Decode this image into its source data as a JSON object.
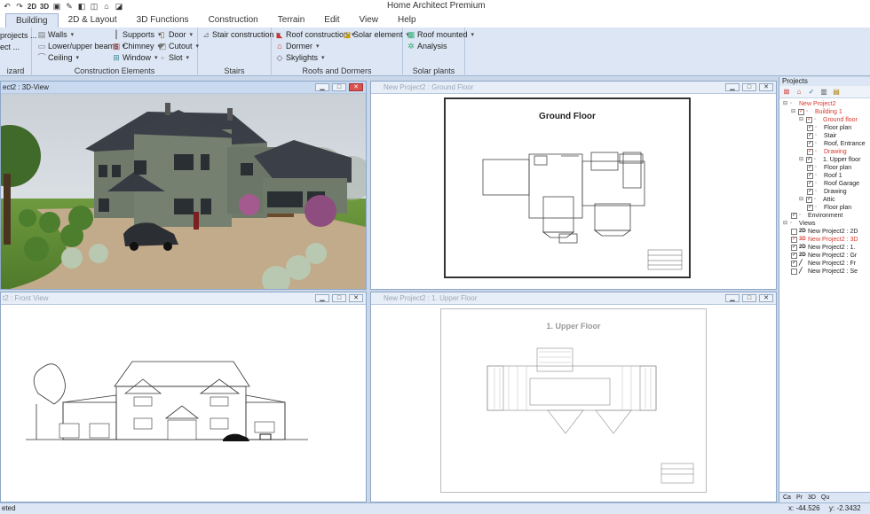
{
  "window": {
    "title": "Home Architect Premium"
  },
  "quick_access": [
    "↶",
    "↷",
    "2D",
    "3D"
  ],
  "tabs": [
    "Building",
    "2D & Layout",
    "3D Functions",
    "Construction",
    "Terrain",
    "Edit",
    "View",
    "Help"
  ],
  "ribbon": {
    "wizard": {
      "items": [
        "projects ...",
        "ect ..."
      ],
      "caption": "izard"
    },
    "construction": {
      "col1": [
        "Walls",
        "Lower/upper beams",
        "Ceiling"
      ],
      "col2": [
        "Supports",
        "Chimney",
        "Window"
      ],
      "col3": [
        "Door",
        "Cutout",
        "Slot"
      ],
      "caption": "Construction Elements"
    },
    "stairs": {
      "items": [
        "Stair construction"
      ],
      "caption": "Stairs"
    },
    "roofs": {
      "items": [
        "Roof construction",
        "Dormer",
        "Skylights",
        "Solar element"
      ],
      "caption": "Roofs and Dormers"
    },
    "solar": {
      "items": [
        "Roof mounted",
        "Analysis"
      ],
      "caption": "Solar plants"
    }
  },
  "views": [
    {
      "title": "ect2 : 3D-View",
      "active": true
    },
    {
      "title": "New Project2 : Ground Floor",
      "drawing_title": "Ground Floor"
    },
    {
      "title": "t2 : Front View"
    },
    {
      "title": "New Project2 : 1. Upper Floor",
      "drawing_title": "1. Upper Floor"
    }
  ],
  "projects_panel": {
    "title": "Projects",
    "tree": [
      {
        "label": "New Project2",
        "level": 0,
        "red": true,
        "toggle": "⊟"
      },
      {
        "label": "Building 1",
        "level": 1,
        "red": true,
        "checked": true,
        "toggle": "⊟"
      },
      {
        "label": "Ground floor",
        "level": 2,
        "red": true,
        "checked": true,
        "toggle": "⊟"
      },
      {
        "label": "Floor plan",
        "level": 3,
        "checked": true
      },
      {
        "label": "Stair",
        "level": 3,
        "checked": true
      },
      {
        "label": "Roof, Entrance",
        "level": 3,
        "checked": true
      },
      {
        "label": "Drawing",
        "level": 3,
        "checked": true,
        "red": true
      },
      {
        "label": "1. Upper floor",
        "level": 2,
        "checked": true,
        "toggle": "⊟"
      },
      {
        "label": "Floor plan",
        "level": 3,
        "checked": true
      },
      {
        "label": "Roof 1",
        "level": 3,
        "checked": true
      },
      {
        "label": "Roof Garage",
        "level": 3,
        "checked": true
      },
      {
        "label": "Drawing",
        "level": 3,
        "checked": true
      },
      {
        "label": "Attic",
        "level": 2,
        "checked": true,
        "toggle": "⊟"
      },
      {
        "label": "Floor plan",
        "level": 3,
        "checked": true
      },
      {
        "label": "Environment",
        "level": 1,
        "checked": true
      },
      {
        "label": "Views",
        "level": 0,
        "toggle": "⊟"
      },
      {
        "label": "New Project2 : 2D",
        "level": 1,
        "checked": false,
        "badge": "2D"
      },
      {
        "label": "New Project2 : 3D",
        "level": 1,
        "checked": true,
        "badge": "3D",
        "red": true
      },
      {
        "label": "New Project2 : 1.",
        "level": 1,
        "checked": true,
        "badge": "2D"
      },
      {
        "label": "New Project2 : Gr",
        "level": 1,
        "checked": true,
        "badge": "2D"
      },
      {
        "label": "New Project2 : Fr",
        "level": 1,
        "checked": true,
        "badge": "╱"
      },
      {
        "label": "New Project2 : Se",
        "level": 1,
        "checked": false,
        "badge": "╱"
      }
    ],
    "bottom_tabs": [
      "Ca",
      "Pr",
      "3D",
      "Qu"
    ]
  },
  "status": {
    "message": "eted",
    "x": "x: -44.526",
    "y": "y: -2.3432"
  }
}
